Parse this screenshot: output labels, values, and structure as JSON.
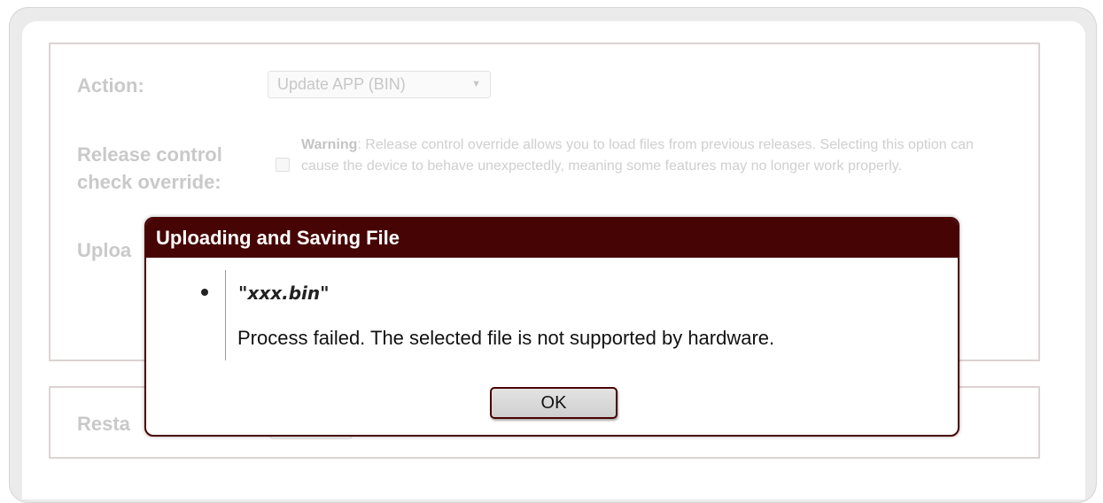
{
  "form": {
    "action_label": "Action:",
    "action_select": "Update APP (BIN)",
    "release_label_line1": "Release control",
    "release_label_line2": "check override:",
    "warning_prefix": "Warning",
    "warning_text": ": Release control override allows you to load files from previous releases. Selecting this option can cause the device to behave unexpectedly, meaning some features may no longer work properly.",
    "upload_label_partial": "Uploa",
    "restart_label_partial": "Resta"
  },
  "dialog": {
    "title": "Uploading and Saving File",
    "filename": "\"xxx.bin\"",
    "message": "Process failed. The selected file is not supported by hardware.",
    "ok_label": "OK"
  },
  "colors": {
    "dialog_title_bg": "#470404",
    "disabled_text": "#c9c9c9"
  }
}
